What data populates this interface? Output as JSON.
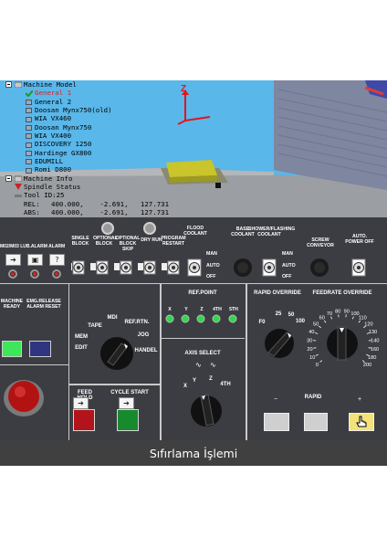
{
  "tree": {
    "machine_model": "Machine Model",
    "models": [
      "General 1",
      "General 2",
      "Doosan Mynx750(old)",
      "WIA VX460",
      "Doosan Mynx750",
      "WIA VX400",
      "DISCOVERY 1250",
      "Hardinge GX800",
      "EDUMILL",
      "Romi D800"
    ],
    "selected_model": "General 1",
    "machine_info": "Machine Info",
    "spindle_status": "Spindle Status",
    "tool_id": "Tool ID:25",
    "rel_label": "REL:",
    "rel_values": "400.000,    -2.691,   127.731",
    "abs_label": "ABS:",
    "abs_values": "400.000,    -2.691,   127.731"
  },
  "axis_label": "Z",
  "panel": {
    "m_lub_alarm": "M02/M03 LUB.ALARM   ALARM",
    "single_block": "SINGLE BLOCK",
    "optional_block": "OPTIONAL BLOCK",
    "optional_block_skip": "OPTIONAL BLOCK SKIP",
    "dry_run": "DRY RUN",
    "program_restart": "PROGRAM RESTART",
    "flood_coolant": "FLOOD COOLANT",
    "base_coolant": "BASE COOLANT",
    "shower_flashing_coolant": "SHOWER/FLASHING COOLANT",
    "screw_conveyor": "SCREW CONVEYOR",
    "auto_power_off": "AUTO. POWER OFF",
    "man": "MAN",
    "auto": "AUTO",
    "off": "OFF",
    "machine_ready": "MACHINE READY",
    "emg_release": "EMG.RELEASE ALARM RESET",
    "mem": "MEM",
    "tape": "TAPE",
    "mdi": "MDI",
    "ref_rtn": "REF.RTN.",
    "edit": "EDIT",
    "jog": "JOG",
    "handel": "HANDEL",
    "ref_point": "REF.POINT",
    "ref_axes": [
      "X",
      "Y",
      "Z",
      "4TH",
      "5TH"
    ],
    "axis_select": "AXIS SELECT",
    "axis_select_labels": [
      "X",
      "Y",
      "Z",
      "4TH"
    ],
    "rapid_override": "RAPID OVERRIDE",
    "feedrate_override": "FEEDRATE OVERRIDE",
    "rapid_marks": [
      "F0",
      "25",
      "50",
      "100"
    ],
    "feed_marks": [
      "0",
      "10",
      "20",
      "30",
      "40",
      "50",
      "60",
      "70",
      "80",
      "90",
      "100",
      "110",
      "120",
      "130",
      "140",
      "160",
      "180",
      "200"
    ],
    "feed_hold": "FEED HOLD",
    "cycle_start": "CYCLE START",
    "rapid": "RAPID",
    "minus": "−",
    "plus": "+"
  },
  "caption": "Sıfırlama İşlemi",
  "colors": {
    "sky": "#59b7ea",
    "panel": "#3c3d43",
    "ready_green": "#3ee65a",
    "reset_blue": "#2f3580",
    "feed_hold_red": "#b3131a",
    "cycle_start_green": "#178a2d",
    "plus_yellow": "#f3e27a"
  }
}
